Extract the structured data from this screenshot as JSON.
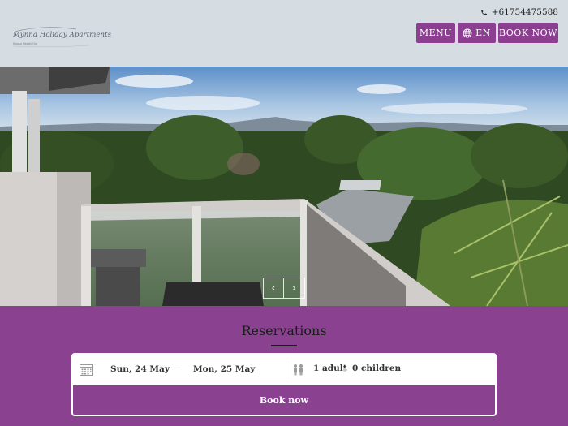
{
  "header": {
    "logo": {
      "name": "Mynna Holiday Apartments",
      "tagline": "Noosa Heads Qld"
    },
    "phone": "+61754475588",
    "menu_label": "MENU",
    "lang_label": "EN",
    "book_label": "BOOK NOW"
  },
  "hero": {
    "prev_arrow": "‹",
    "next_arrow": "›"
  },
  "reservations": {
    "title": "Reservations",
    "checkin": "Sun, 24 May",
    "separator": "—",
    "checkout": "Mon, 25 May",
    "adults": "1 adult",
    "children": "0 children",
    "submit_label": "Book now"
  },
  "colors": {
    "accent": "#8a4190",
    "header_bg": "#d6dde2"
  },
  "icons": [
    "phone-icon",
    "globe-icon",
    "calendar-icon",
    "guests-icon"
  ]
}
